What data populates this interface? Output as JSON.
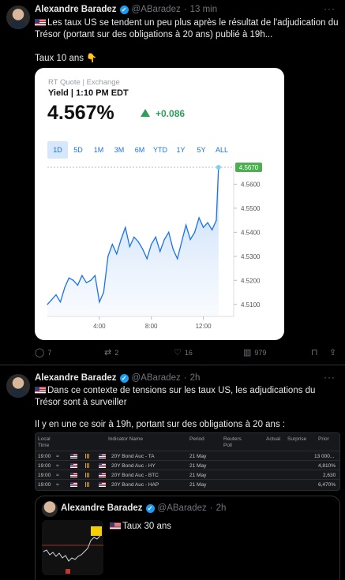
{
  "tweet1": {
    "author": "Alexandre Baradez",
    "handle": "@ABaradez",
    "time": "13 min",
    "text_line1": "Les taux US se tendent un peu plus après le résultat de l'adjudication du",
    "text_line2": "Trésor (portant sur des obligations à 20 ans) publié à 19h...",
    "text_line3": "Taux 10 ans",
    "quote_card": {
      "source": "RT Quote | Exchange",
      "yield_label": "Yield | 1:10 PM EDT",
      "price": "4.567%",
      "change": "+0.086",
      "tabs": [
        "1D",
        "5D",
        "1M",
        "3M",
        "6M",
        "YTD",
        "1Y",
        "5Y",
        "ALL"
      ],
      "active_tab": "1D",
      "current_label": "4.5670"
    },
    "actions": {
      "replies": "7",
      "retweets": "2",
      "likes": "16",
      "views": "979"
    }
  },
  "chart_data": {
    "type": "area",
    "title": "",
    "xlabel": "",
    "ylabel": "",
    "x_ticks": [
      "4:00",
      "8:00",
      "12:00"
    ],
    "y_ticks": [
      "4.5100",
      "4.5200",
      "4.5300",
      "4.5400",
      "4.5500",
      "4.5600"
    ],
    "ylim": [
      4.505,
      4.568
    ],
    "reference_line": 4.567,
    "x": [
      "0:00",
      "0:20",
      "0:40",
      "1:00",
      "1:20",
      "1:40",
      "2:00",
      "2:20",
      "2:40",
      "3:00",
      "3:20",
      "3:40",
      "4:00",
      "4:20",
      "4:40",
      "5:00",
      "5:20",
      "5:40",
      "6:00",
      "6:20",
      "6:40",
      "7:00",
      "7:20",
      "7:40",
      "8:00",
      "8:20",
      "8:40",
      "9:00",
      "9:20",
      "9:40",
      "10:00",
      "10:20",
      "10:40",
      "11:00",
      "11:20",
      "11:40",
      "12:00",
      "12:20",
      "12:40",
      "13:00",
      "13:10"
    ],
    "values": [
      4.51,
      4.512,
      4.514,
      4.511,
      4.517,
      4.521,
      4.52,
      4.518,
      4.522,
      4.519,
      4.52,
      4.522,
      4.511,
      4.515,
      4.53,
      4.535,
      4.531,
      4.537,
      4.542,
      4.534,
      4.538,
      4.536,
      4.533,
      4.529,
      4.535,
      4.538,
      4.532,
      4.537,
      4.54,
      4.533,
      4.529,
      4.536,
      4.543,
      4.537,
      4.54,
      4.546,
      4.542,
      4.544,
      4.541,
      4.545,
      4.567
    ]
  },
  "tweet2": {
    "author": "Alexandre Baradez",
    "handle": "@ABaradez",
    "time": "2h",
    "text_line1": "Dans ce contexte de tensions sur les taux US, les adjudications du",
    "text_line2": "Trésor sont à surveiller",
    "text_line3": "Il y en une ce soir à 19h, portant sur des obligations à 20 ans :",
    "calendar": {
      "headers": {
        "local_time": "Local Time",
        "indicator": "Indicator Name",
        "period": "Period",
        "reuters_poll": "Reuters Poll",
        "actual": "Actual",
        "surprise": "Surprise",
        "prior": "Prior"
      },
      "rows": [
        {
          "time": "19:00",
          "name": "20Y Bond Auc - TA",
          "period": "21 May",
          "prior": "13 000..."
        },
        {
          "time": "19:00",
          "name": "20Y Bond Auc - HY",
          "period": "21 May",
          "prior": "4,810%"
        },
        {
          "time": "19:00",
          "name": "20Y Bond Auc - BTC",
          "period": "21 May",
          "prior": "2,630"
        },
        {
          "time": "19:00",
          "name": "20Y Bond Auc - HAP",
          "period": "21 May",
          "prior": "6,470%"
        }
      ]
    },
    "quoted": {
      "author": "Alexandre Baradez",
      "handle": "@ABaradez",
      "time": "2h",
      "text": "Taux 30 ans"
    }
  }
}
